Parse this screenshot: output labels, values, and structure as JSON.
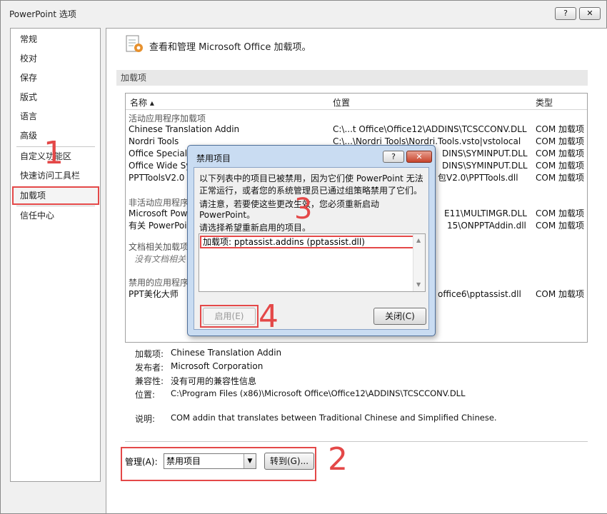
{
  "window": {
    "title": "PowerPoint 选项",
    "help_label": "?",
    "close_label": "✕"
  },
  "sidebar": {
    "items": [
      {
        "label": "常规"
      },
      {
        "label": "校对"
      },
      {
        "label": "保存"
      },
      {
        "label": "版式"
      },
      {
        "label": "语言"
      },
      {
        "label": "高级"
      },
      {
        "label": "自定义功能区"
      },
      {
        "label": "快速访问工具栏"
      },
      {
        "label": "加载项"
      },
      {
        "label": "信任中心"
      }
    ],
    "selected": "加载项"
  },
  "header": {
    "text": "查看和管理 Microsoft Office 加载项。"
  },
  "section_title": "加载项",
  "table": {
    "columns": [
      "名称 ▴",
      "位置",
      "类型"
    ],
    "groups": [
      {
        "title": "活动应用程序加载项"
      },
      {
        "title": "非活动应用程序"
      },
      {
        "title": "文档相关加载项"
      },
      {
        "title": "禁用的应用程序"
      }
    ],
    "rows": [
      {
        "name": "Chinese Translation Addin",
        "location": "C:\\...t Office\\Office12\\ADDINS\\TCSCCONV.DLL",
        "type": "COM 加载项"
      },
      {
        "name": "Nordri Tools",
        "location": "C:\\...\\Nordri Tools\\Nordri.Tools.vsto|vstolocal",
        "type": "COM 加载项"
      },
      {
        "name": "Office Special",
        "location": "DINS\\SYMINPUT.DLL",
        "type": "COM 加载项"
      },
      {
        "name": "Office Wide Sy",
        "location": "DINS\\SYMINPUT.DLL",
        "type": "COM 加载项"
      },
      {
        "name": "PPTToolsV2.0",
        "location": "包V2.0\\PPTTools.dll",
        "type": "COM 加载项"
      },
      {
        "name": "Microsoft Pow",
        "location": "E11\\MULTIMGR.DLL",
        "type": "COM 加载项"
      },
      {
        "name": "有关 PowerPoi",
        "location": "15\\ONPPTAddin.dll",
        "type": "COM 加载项"
      },
      {
        "name": "PPT美化大师",
        "location": "office6\\pptassist.dll",
        "type": "COM 加载项"
      }
    ],
    "no_doc_addins": "没有文档相关"
  },
  "details": {
    "addin_label": "加载项:",
    "addin_value": "Chinese Translation Addin",
    "publisher_label": "发布者:",
    "publisher_value": "Microsoft Corporation",
    "compat_label": "兼容性:",
    "compat_value": "没有可用的兼容性信息",
    "location_label": "位置:",
    "location_value": "C:\\Program Files (x86)\\Microsoft Office\\Office12\\ADDINS\\TCSCCONV.DLL",
    "desc_label": "说明:",
    "desc_value": "COM addin that translates between Traditional Chinese and Simplified Chinese."
  },
  "manage": {
    "label": "管理(A):",
    "selected": "禁用项目",
    "go_label": "转到(G)..."
  },
  "dialog": {
    "title": "禁用项目",
    "help_label": "?",
    "close_label": "✕",
    "line1": "以下列表中的项目已被禁用，因为它们使 PowerPoint 无法",
    "line2": "正常运行，或者您的系统管理员已通过组策略禁用了它们。",
    "line3": "请注意，若要使这些更改生效，您必须重新启动",
    "line4": "PowerPoint。",
    "line5": "请选择希望重新启用的项目。",
    "item": "加载项: pptassist.addins (pptassist.dll)",
    "enable_label": "启用(E)",
    "close_button_label": "关闭(C)"
  },
  "annotations": {
    "n1": "1",
    "n2": "2",
    "n3": "3",
    "n4": "4"
  },
  "colors": {
    "annotation": "#e44848"
  }
}
